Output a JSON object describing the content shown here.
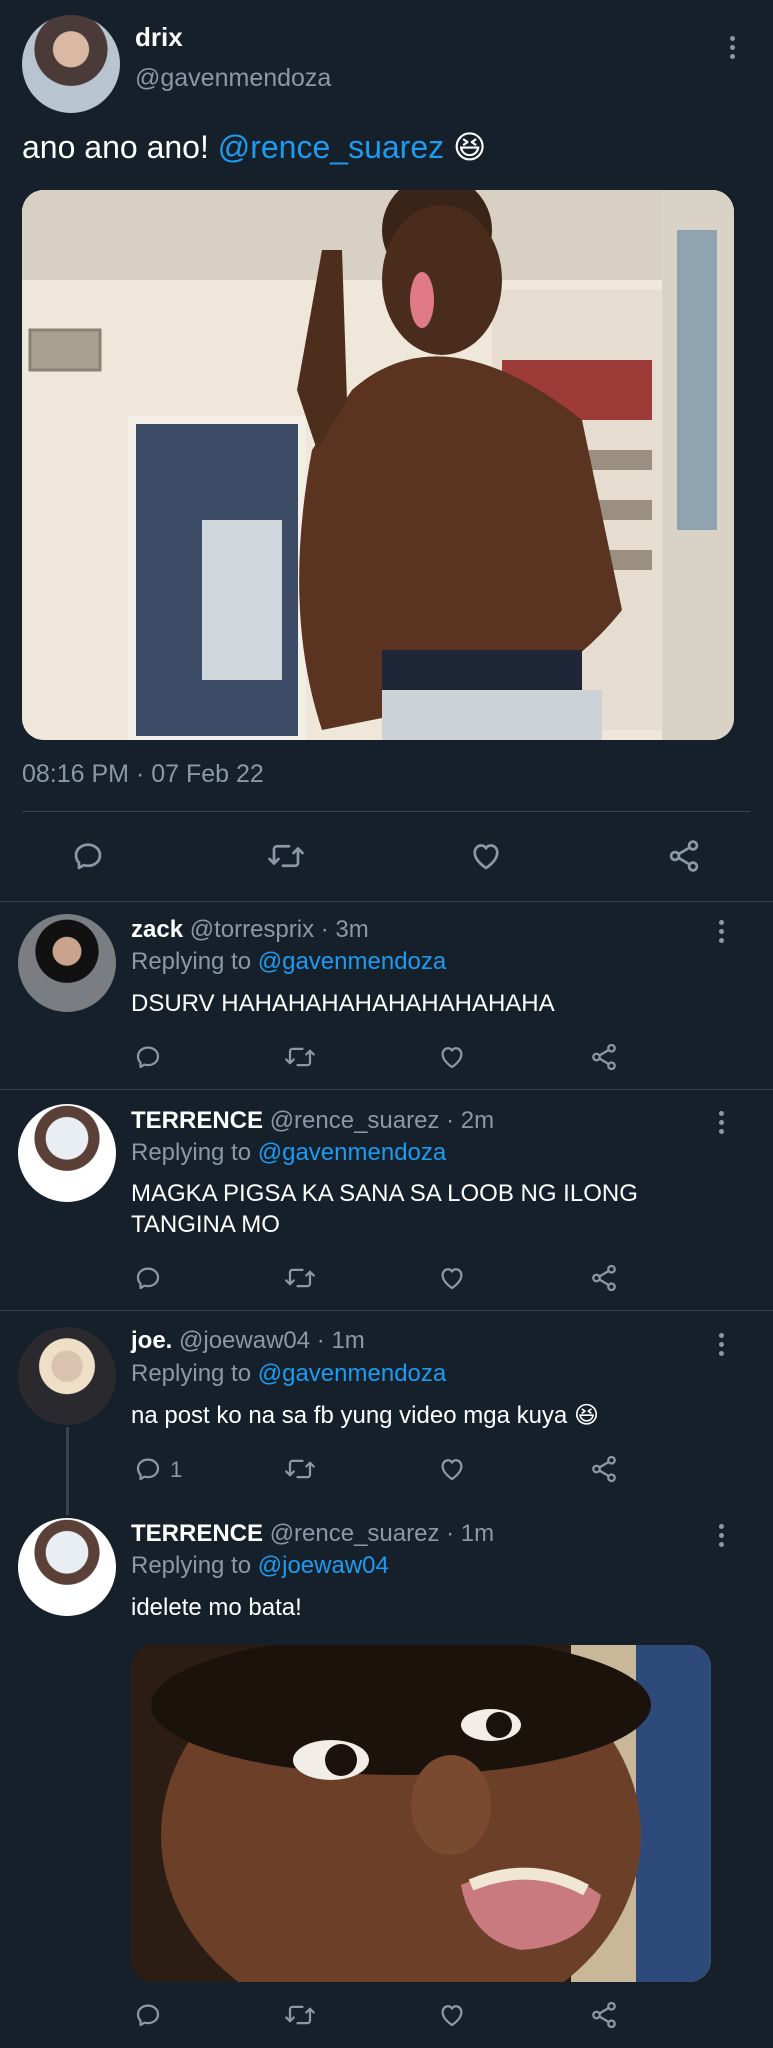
{
  "tweet": {
    "display_name": "drix",
    "handle": "@gavenmendoza",
    "text": "ano ano ano! ",
    "mention": "@rence_suarez",
    "emoji": "😆",
    "timestamp": "08:16 PM · 07 Feb 22"
  },
  "replies": [
    {
      "display_name": "zack",
      "handle_time": "@torresprix · 3m",
      "replying_prefix": "Replying to ",
      "replying_to": "@gavenmendoza",
      "text": "DSURV HAHAHAHAHAHAHAHAHAHA"
    },
    {
      "display_name": "TERRENCE",
      "handle_time": "@rence_suarez · 2m",
      "replying_prefix": "Replying to ",
      "replying_to": "@gavenmendoza",
      "text_line1": "MAGKA PIGSA KA SANA SA LOOB NG ILONG",
      "text_line2": "TANGINA MO"
    },
    {
      "display_name": "joe.",
      "handle_time": "@joewaw04 · 1m",
      "replying_prefix": "Replying to ",
      "replying_to": "@gavenmendoza",
      "text": "na post ko na sa fb yung video mga kuya ",
      "emoji": "😆",
      "reply_count": "1"
    },
    {
      "display_name": "TERRENCE",
      "handle_time": "@rence_suarez · 1m",
      "replying_prefix": "Replying to ",
      "replying_to": "@joewaw04",
      "text": "idelete mo bata!"
    }
  ],
  "colors": {
    "background": "#15202b",
    "accent": "#1d9bf0",
    "muted": "#8b98a5",
    "divider": "#38444d"
  }
}
